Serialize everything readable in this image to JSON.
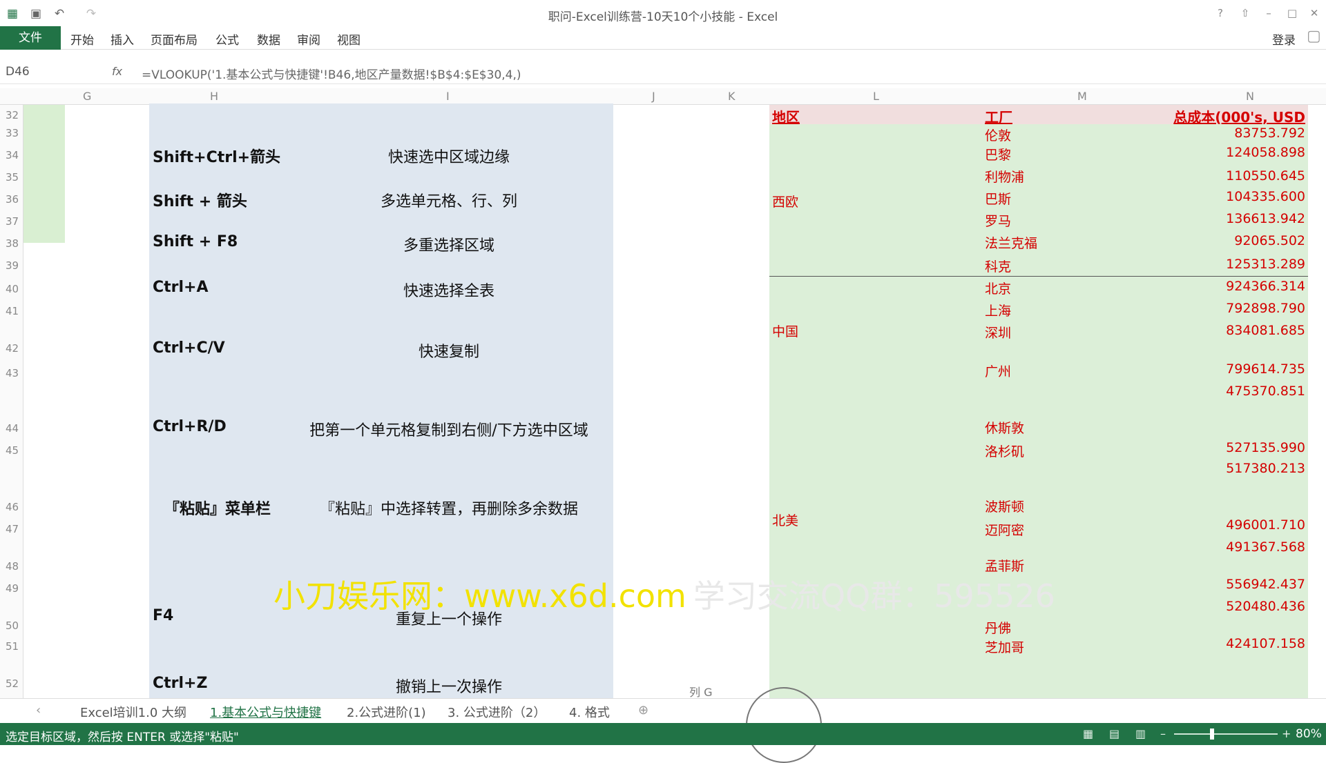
{
  "title_bar": {
    "title": "职问-Excel训练营-10天10个小技能 - Excel",
    "window_buttons": [
      "?",
      "⇧",
      "–",
      "□",
      "✕"
    ]
  },
  "menu": {
    "file": "文件",
    "items": [
      "开始",
      "插入",
      "页面布局",
      "公式",
      "数据",
      "审阅",
      "视图"
    ],
    "login": "登录"
  },
  "formula_bar": {
    "name_box": "D46",
    "fx": "fx",
    "formula": "=VLOOKUP('1.基本公式与快捷键'!B46,地区产量数据!$B$4:$E$30,4,)"
  },
  "columns": [
    "G",
    "H",
    "I",
    "J",
    "K",
    "L",
    "M",
    "N"
  ],
  "rows": [
    "32",
    "33",
    "34",
    "35",
    "36",
    "37",
    "38",
    "39",
    "40",
    "41",
    "42",
    "43",
    "44",
    "45",
    "46",
    "47",
    "48",
    "49",
    "50",
    "51",
    "52"
  ],
  "shortcuts": [
    {
      "key": "Shift+Ctrl+箭头",
      "desc": "快速选中区域边缘"
    },
    {
      "key": "Shift + 箭头",
      "desc": "多选单元格、行、列"
    },
    {
      "key": "Shift + F8",
      "desc": "多重选择区域"
    },
    {
      "key": "Ctrl+A",
      "desc": "快速选择全表"
    },
    {
      "key": "Ctrl+C/V",
      "desc": "快速复制"
    },
    {
      "key": "Ctrl+R/D",
      "desc": "把第一个单元格复制到右侧/下方选中区域"
    },
    {
      "key": "『粘贴』菜单栏",
      "desc": "『粘贴』中选择转置，再删除多余数据"
    },
    {
      "key": "F4",
      "desc": "重复上一个操作"
    },
    {
      "key": "Ctrl+Z",
      "desc": "撤销上一次操作"
    }
  ],
  "right_table": {
    "headers": {
      "region": "地区",
      "factory": "工厂",
      "cost": "总成本(000's, USD"
    },
    "regions": [
      "西欧",
      "中国",
      "北美"
    ],
    "factories": [
      "伦敦",
      "巴黎",
      "利物浦",
      "巴斯",
      "罗马",
      "法兰克福",
      "科克",
      "北京",
      "上海",
      "深圳",
      "广州",
      "休斯敦",
      "洛杉矶",
      "波斯顿",
      "迈阿密",
      "孟菲斯",
      "丹佛",
      "芝加哥"
    ],
    "costs": [
      "83753.792",
      "124058.898",
      "110550.645",
      "104335.600",
      "136613.942",
      "92065.502",
      "125313.289",
      "924366.314",
      "792898.790",
      "834081.685",
      "799614.735",
      "475370.851",
      "527135.990",
      "517380.213",
      "496001.710",
      "491367.568",
      "556942.437",
      "520480.436",
      "424107.158"
    ]
  },
  "watermark": {
    "site": "小刀娱乐网：www.x6d.com",
    "qq": "学习交流QQ群：595526"
  },
  "sheet_tabs": [
    "Excel培训1.0 大纲",
    "1.基本公式与快捷键",
    "2.公式进阶(1)",
    "3. 公式进阶（2）",
    "4. 格式"
  ],
  "cell_hint": "列 G",
  "status": {
    "text": "选定目标区域，然后按 ENTER 或选择\"粘贴\"",
    "zoom": "80%"
  },
  "colors": {
    "accent": "#217346",
    "red_text": "#d40000",
    "green_fill": "#dcefd8",
    "blue_fill": "#dfe7f0"
  }
}
